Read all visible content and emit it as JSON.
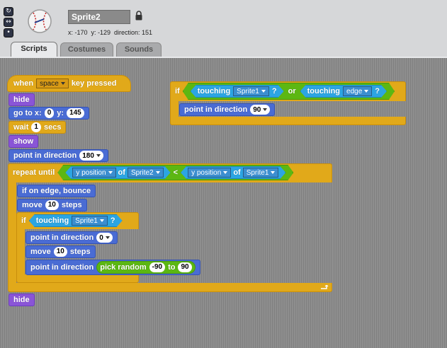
{
  "header": {
    "sprite_name": "Sprite2",
    "info": "x: -170  y: -129  direction: 151",
    "rotation_buttons": [
      "↻",
      "↔",
      "•"
    ]
  },
  "tabs": [
    {
      "label": "Scripts",
      "active": true
    },
    {
      "label": "Costumes",
      "active": false
    },
    {
      "label": "Sounds",
      "active": false
    }
  ],
  "colors": {
    "control": "#e1a91a",
    "looks": "#8a55d7",
    "motion": "#4a6cd4",
    "operators": "#5cb712",
    "sensing": "#2ca5e2"
  },
  "script1": {
    "hat": {
      "label": "when",
      "key": "space",
      "suffix": "key pressed"
    },
    "hide1": "hide",
    "goto": {
      "label": "go to x:",
      "x": "0",
      "ylabel": "y:",
      "y": "145"
    },
    "wait": {
      "label": "wait",
      "value": "1",
      "suffix": "secs"
    },
    "show": "show",
    "point1": {
      "label": "point in direction",
      "value": "180"
    },
    "repeat": {
      "label": "repeat until",
      "left": {
        "prop": "y position",
        "of": "of",
        "sprite": "Sprite2"
      },
      "op": "<",
      "right": {
        "prop": "y position",
        "of": "of",
        "sprite": "Sprite1"
      }
    },
    "bounce": "if on edge, bounce",
    "move1": {
      "label": "move",
      "value": "10",
      "suffix": "steps"
    },
    "if_inner": {
      "label": "if",
      "touching": "touching",
      "target": "Sprite1",
      "q": "?"
    },
    "point2": {
      "label": "point in direction",
      "value": "0"
    },
    "move2": {
      "label": "move",
      "value": "10",
      "suffix": "steps"
    },
    "point3": {
      "label": "point in direction",
      "random": "pick random",
      "from": "-90",
      "to": "to",
      "to_value": "90"
    },
    "hide2": "hide"
  },
  "script2": {
    "if_label": "if",
    "touching1": {
      "label": "touching",
      "target": "Sprite1",
      "q": "?"
    },
    "or": "or",
    "touching2": {
      "label": "touching",
      "target": "edge",
      "q": "?"
    },
    "point": {
      "label": "point in direction",
      "value": "90"
    }
  }
}
